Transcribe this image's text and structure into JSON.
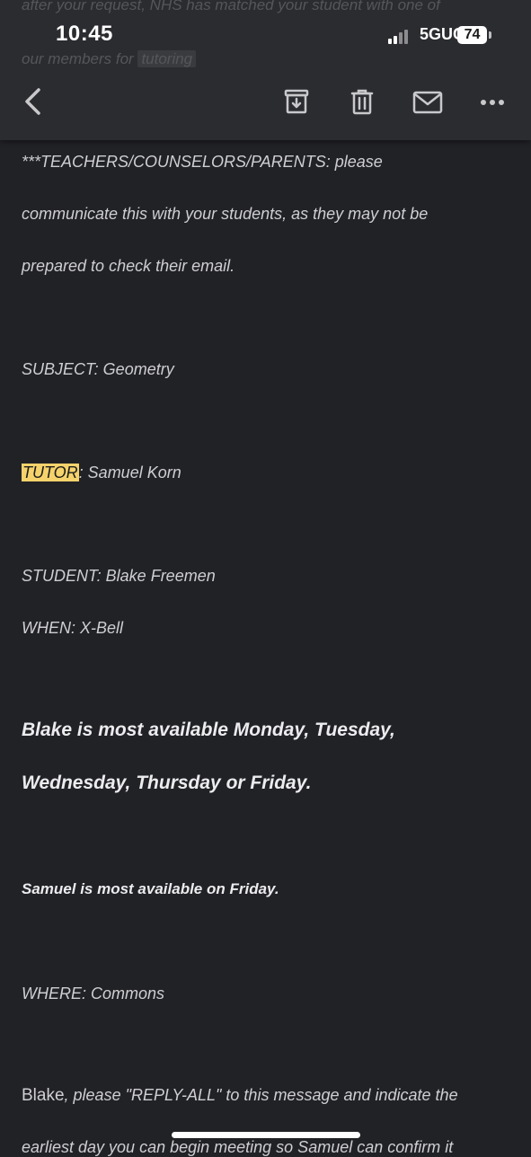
{
  "status_bar": {
    "time": "10:45",
    "network": "5GUC",
    "battery": "74"
  },
  "email_header_behind": {
    "line1": "after your request, NHS has matched your student with one of",
    "line2_prefix": "our members for",
    "line2_chip": "tutoring"
  },
  "toolbar": {
    "back_icon": "chevron-left-icon",
    "archive_icon": "archive-icon",
    "delete_icon": "trash-icon",
    "mark_unread_icon": "envelope-icon",
    "more_icon": "more-horizontal-icon"
  },
  "body": {
    "notice_1": "***TEACHERS/COUNSELORS/PARENTS: please",
    "notice_2": "communicate this with your students, as they may not be",
    "notice_3": "prepared to check their email.",
    "subject": "SUBJECT: Geometry",
    "tutor_label": "TUTOR",
    "tutor_value": ": Samuel Korn",
    "student": "STUDENT: Blake Freemen",
    "when": "WHEN: X-Bell",
    "blake_avail_1": "Blake is most available Monday, Tuesday,",
    "blake_avail_2": "Wednesday, Thursday or Friday.",
    "samuel_avail": "Samuel is most available on Friday.",
    "where": "WHERE: Commons",
    "reply_name": "Blake",
    "reply_rest": ", please \"REPLY-ALL\" to this message and indicate the",
    "reply_line2": "earliest day you can begin meeting so Samuel can confirm it"
  },
  "colors": {
    "background": "#212226",
    "toolbar": "#2b2c30",
    "highlight": "#f5d26b"
  }
}
